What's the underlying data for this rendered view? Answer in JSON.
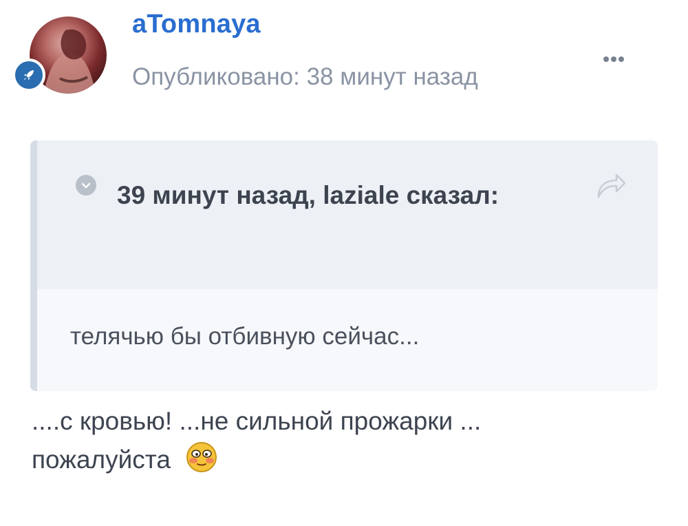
{
  "post": {
    "author": {
      "name": "aTomnaya",
      "avatar_icon": "avatar-photo",
      "rank_icon": "rocket-icon",
      "rank_color": "#2a6db0"
    },
    "published": "Опубликовано: 38 минут назад",
    "menu_icon": "more-dots-icon",
    "quote": {
      "citation": "39 минут назад, laziale сказал:",
      "body": "телячью бы отбивную сейчас...",
      "toggle_icon": "chevron-down-icon",
      "share_icon": "share-arrow-icon"
    },
    "content_line1": "....с кровью! ...не сильной прожарки ...",
    "content_line2": "пожалуйста",
    "emoji_icon": "blushing-emoji-icon"
  },
  "colors": {
    "author_name": "#2a6dd0",
    "meta_text": "#8a93a3",
    "quote_header_bg": "#edf0f4",
    "quote_body_bg": "#f6f8fb"
  }
}
